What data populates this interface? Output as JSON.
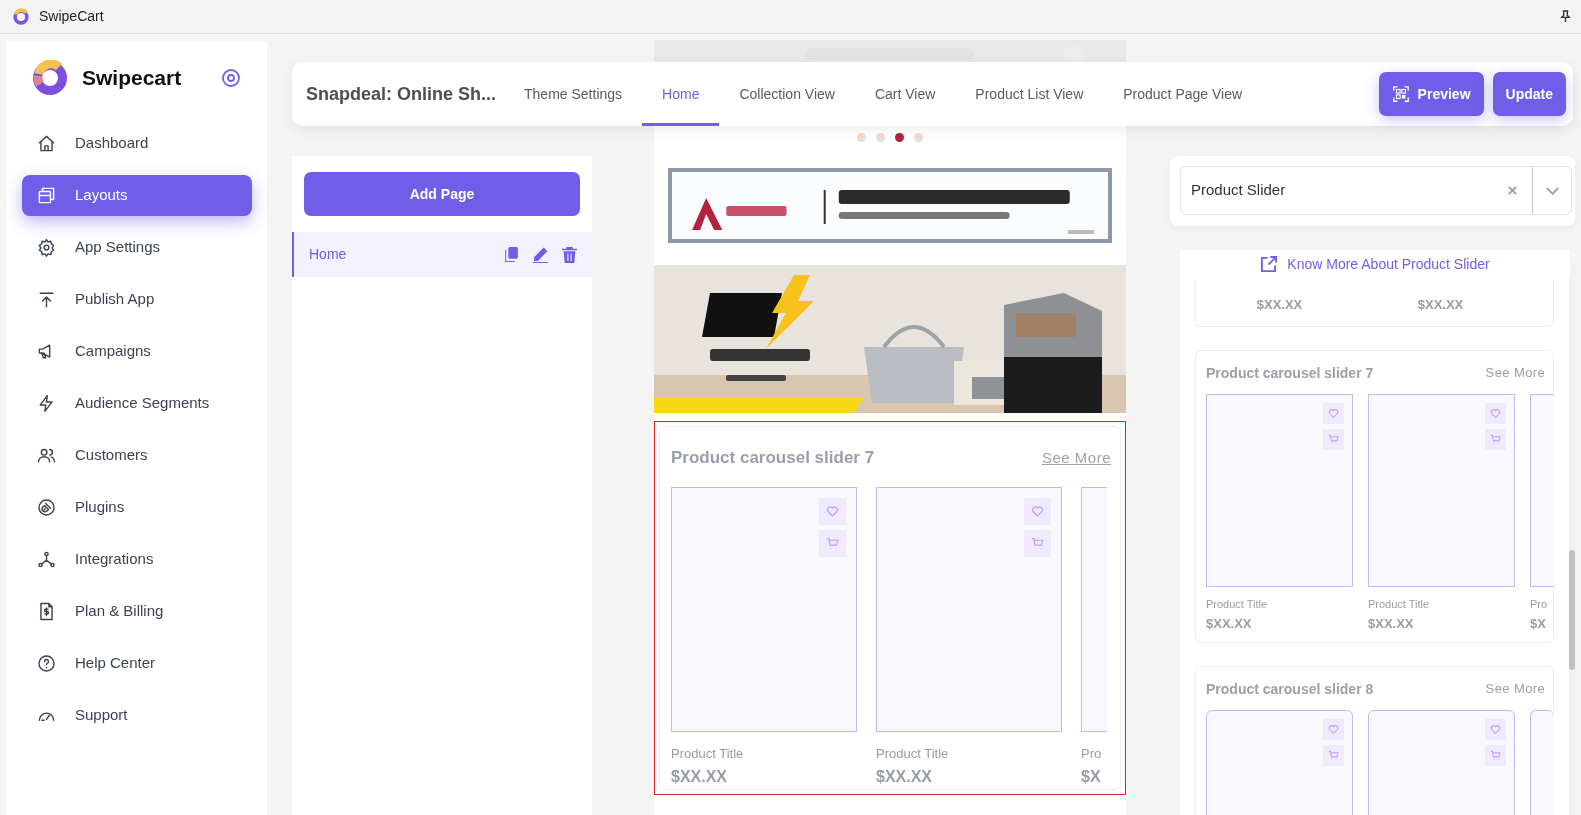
{
  "window": {
    "title": "SwipeCart"
  },
  "sidebar": {
    "brand": "Swipecart",
    "items": [
      {
        "label": "Dashboard",
        "selected": false
      },
      {
        "label": "Layouts",
        "selected": true
      },
      {
        "label": "App Settings",
        "selected": false
      },
      {
        "label": "Publish App",
        "selected": false
      },
      {
        "label": "Campaigns",
        "selected": false
      },
      {
        "label": "Audience Segments",
        "selected": false
      },
      {
        "label": "Customers",
        "selected": false
      },
      {
        "label": "Plugins",
        "selected": false
      },
      {
        "label": "Integrations",
        "selected": false
      },
      {
        "label": "Plan & Billing",
        "selected": false
      },
      {
        "label": "Help Center",
        "selected": false
      },
      {
        "label": "Support",
        "selected": false
      }
    ]
  },
  "topbar": {
    "page_title": "Snapdeal: Online Sh...",
    "tabs": [
      {
        "label": "Theme Settings",
        "selected": false
      },
      {
        "label": "Home",
        "selected": true
      },
      {
        "label": "Collection View",
        "selected": false
      },
      {
        "label": "Cart View",
        "selected": false
      },
      {
        "label": "Product List View",
        "selected": false
      },
      {
        "label": "Product Page View",
        "selected": false
      }
    ],
    "buttons": [
      {
        "label": "Preview",
        "kind": "qr"
      },
      {
        "label": "Update",
        "kind": "plain"
      }
    ]
  },
  "pages": {
    "add_button": "Add Page",
    "items": [
      {
        "label": "Home",
        "selected": true
      }
    ]
  },
  "preview": {
    "dots": [
      {
        "selected": false
      },
      {
        "selected": false
      },
      {
        "selected": true
      },
      {
        "selected": false
      }
    ],
    "carousel": {
      "title": "Product carousel slider 7",
      "link": "See More",
      "selected": true,
      "products": [
        {
          "title": "Product Title",
          "price": "$XX.XX"
        },
        {
          "title": "Product Title",
          "price": "$XX.XX"
        },
        {
          "title": "Pro",
          "price": "$X"
        }
      ]
    }
  },
  "component_picker": {
    "value": "Product Slider",
    "help_link": "Know More About Product Slider",
    "cards": [
      {
        "kind": "partial",
        "products": [
          {
            "price": "$XX.XX"
          },
          {
            "price": "$XX.XX"
          }
        ]
      },
      {
        "kind": "carousel",
        "rounded": false,
        "title": "Product carousel slider 7",
        "link": "See More",
        "products": [
          {
            "title": "Product Title",
            "price": "$XX.XX"
          },
          {
            "title": "Product Title",
            "price": "$XX.XX"
          },
          {
            "title": "Pro",
            "price": "$X"
          }
        ]
      },
      {
        "kind": "carousel",
        "rounded": true,
        "title": "Product carousel slider 8",
        "link": "See More"
      }
    ]
  }
}
